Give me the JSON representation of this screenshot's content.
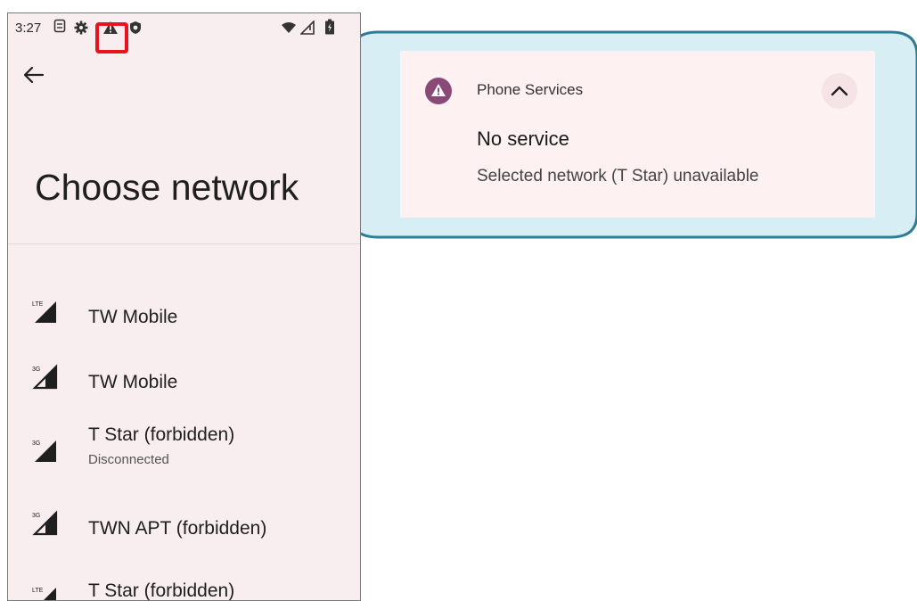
{
  "status_bar": {
    "time": "3:27",
    "icons": [
      "sim-icon",
      "settings-icon",
      "alert-icon",
      "shield-icon",
      "wifi-icon",
      "signal-icon",
      "battery-icon"
    ]
  },
  "screen": {
    "title": "Choose network",
    "back_icon": "arrow-back-icon"
  },
  "networks": [
    {
      "name": "TW Mobile",
      "tech": "LTE",
      "status": ""
    },
    {
      "name": "TW Mobile",
      "tech": "3G",
      "status": ""
    },
    {
      "name": "T Star (forbidden)",
      "tech": "3G",
      "status": "Disconnected"
    },
    {
      "name": "TWN APT (forbidden)",
      "tech": "3G",
      "status": ""
    },
    {
      "name": "T Star (forbidden)",
      "tech": "LTE",
      "status": ""
    }
  ],
  "notification": {
    "app_name": "Phone Services",
    "title": "No service",
    "text": "Selected network (T Star) unavailable",
    "icon": "alert-icon",
    "expand_icon": "chevron-up-icon"
  },
  "colors": {
    "phone_bg": "#f8eeef",
    "callout_fill": "#d6eef4",
    "callout_stroke": "#2e7d95",
    "highlight": "#e8131c",
    "notif_icon_bg": "#8a4a78"
  }
}
